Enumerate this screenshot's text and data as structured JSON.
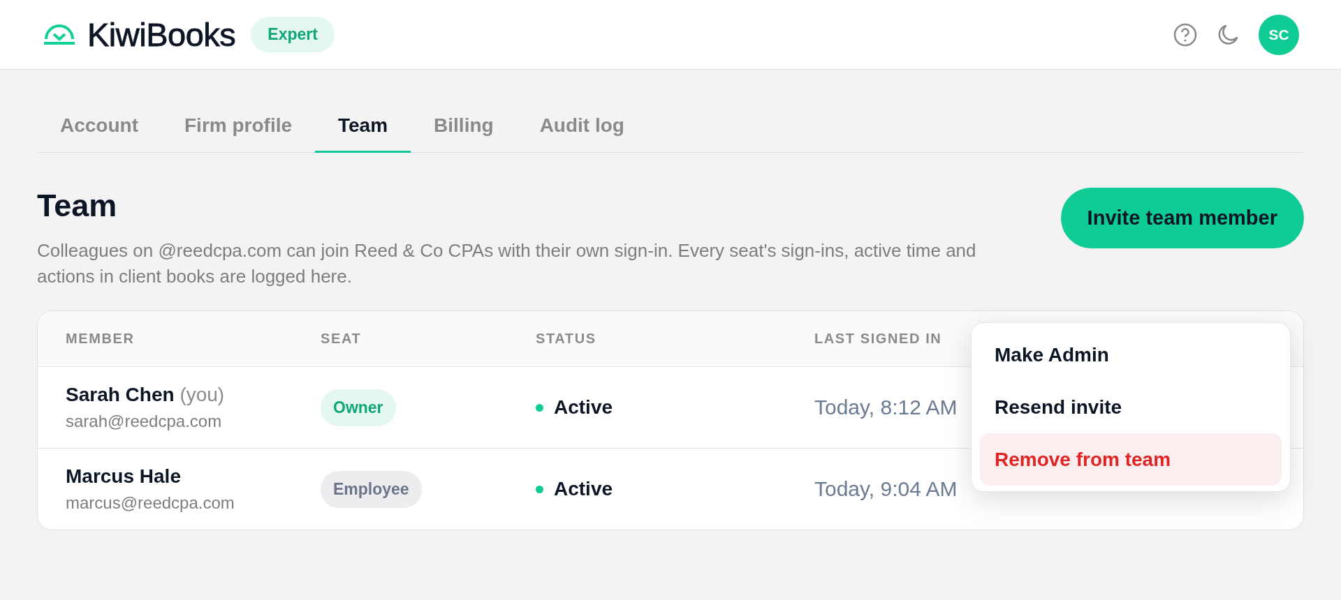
{
  "header": {
    "brand": "KiwiBooks",
    "plan_badge": "Expert",
    "avatar_initials": "SC"
  },
  "tabs": [
    {
      "label": "Account",
      "selected": false
    },
    {
      "label": "Firm profile",
      "selected": false
    },
    {
      "label": "Team",
      "selected": true
    },
    {
      "label": "Billing",
      "selected": false
    },
    {
      "label": "Audit log",
      "selected": false
    }
  ],
  "section": {
    "title": "Team",
    "description": "Colleagues on @reedcpa.com can join Reed & Co CPAs with their own sign-in. Every seat's sign-ins, active time and actions in client books are logged here.",
    "invite_button": "Invite team member"
  },
  "table": {
    "columns": [
      "MEMBER",
      "SEAT",
      "STATUS",
      "LAST SIGNED IN"
    ],
    "rows": [
      {
        "name": "Sarah Chen",
        "you_label": "(you)",
        "email": "sarah@reedcpa.com",
        "seat": "Owner",
        "kind": "owner",
        "status": "Active",
        "last_signed_in": "Today, 8:12 AM"
      },
      {
        "name": "Marcus Hale",
        "email": "marcus@reedcpa.com",
        "seat": "Employee",
        "kind": "employee",
        "status": "Active",
        "last_signed_in": "Today, 9:04 AM"
      }
    ]
  },
  "menu": {
    "items": [
      {
        "label": "Make Admin",
        "kind": "normal",
        "selected": false
      },
      {
        "label": "Resend invite",
        "kind": "normal",
        "selected": false
      },
      {
        "label": "Remove from team",
        "kind": "danger",
        "selected": true
      }
    ]
  }
}
